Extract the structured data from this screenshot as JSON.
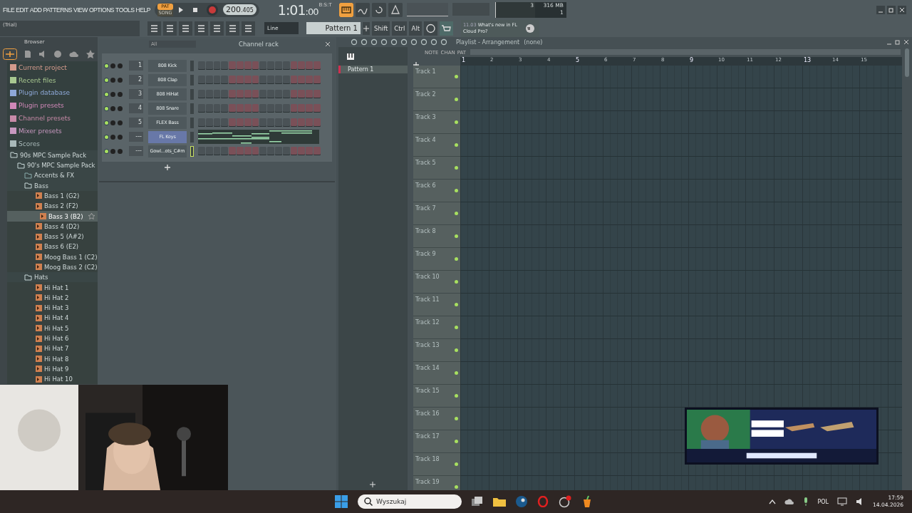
{
  "menu": [
    "FILE",
    "EDIT",
    "ADD",
    "PATTERNS",
    "VIEW",
    "OPTIONS",
    "TOOLS",
    "HELP"
  ],
  "transport": {
    "pat_label": "PAT",
    "song_label": "SONG",
    "song_mode": false,
    "recording": false,
    "tempo": "200",
    "tempo_fraction": ".405",
    "time": "1:01",
    "time_ticks": ":00",
    "time_format": "B:S:T"
  },
  "monitor": {
    "cpu": "3",
    "memory": "316 MB",
    "polyphony": "1"
  },
  "hint_bar": "(Trial)",
  "toolbar": {
    "snap": "Line",
    "pattern": "Pattern 1",
    "modifiers": [
      "Shift",
      "Ctrl",
      "Alt"
    ]
  },
  "news": {
    "time": "11.03",
    "text": "What's new in FL Cloud Pro?"
  },
  "browser": {
    "title": "Browser",
    "items": [
      {
        "label": "Current project",
        "kind": "shortcut",
        "color": "#d49a8c",
        "selected": false
      },
      {
        "label": "Recent files",
        "kind": "shortcut",
        "color": "#a8c890",
        "selected": false
      },
      {
        "label": "Plugin database",
        "kind": "shortcut",
        "color": "#8ea8d8",
        "selected": false
      },
      {
        "label": "Plugin presets",
        "kind": "shortcut",
        "color": "#d088b8",
        "selected": false
      },
      {
        "label": "Channel presets",
        "kind": "shortcut",
        "color": "#c88aa8",
        "selected": false
      },
      {
        "label": "Mixer presets",
        "kind": "shortcut",
        "color": "#c898c0",
        "selected": false
      },
      {
        "label": "Scores",
        "kind": "shortcut",
        "color": "#a8b8b8",
        "selected": false
      },
      {
        "label": "90s MPC Sample Pack",
        "kind": "folder",
        "expanded": true,
        "selected": false,
        "children": [
          {
            "label": "90's MPC Sample Pack",
            "kind": "folder",
            "expanded": true,
            "selected": false,
            "children": [
              {
                "label": "Accents & FX",
                "kind": "folder",
                "expanded": false,
                "selected": false
              },
              {
                "label": "Bass",
                "kind": "folder",
                "expanded": true,
                "selected": false,
                "children": [
                  {
                    "label": "Bass 1 (G2)",
                    "kind": "sample",
                    "selected": false
                  },
                  {
                    "label": "Bass 2 (F2)",
                    "kind": "sample",
                    "selected": false
                  },
                  {
                    "label": "Bass 3 (B2)",
                    "kind": "sample",
                    "selected": true
                  },
                  {
                    "label": "Bass 4 (D2)",
                    "kind": "sample",
                    "selected": false
                  },
                  {
                    "label": "Bass 5 (A#2)",
                    "kind": "sample",
                    "selected": false
                  },
                  {
                    "label": "Bass 6 (E2)",
                    "kind": "sample",
                    "selected": false
                  },
                  {
                    "label": "Moog Bass 1 (C2)",
                    "kind": "sample",
                    "selected": false
                  },
                  {
                    "label": "Moog Bass 2 (C2)",
                    "kind": "sample",
                    "selected": false
                  }
                ]
              },
              {
                "label": "Hats",
                "kind": "folder",
                "expanded": true,
                "selected": false,
                "children": [
                  {
                    "label": "Hi Hat 1",
                    "kind": "sample",
                    "selected": false
                  },
                  {
                    "label": "Hi Hat 2",
                    "kind": "sample",
                    "selected": false
                  },
                  {
                    "label": "Hi Hat 3",
                    "kind": "sample",
                    "selected": false
                  },
                  {
                    "label": "Hi Hat 4",
                    "kind": "sample",
                    "selected": false
                  },
                  {
                    "label": "Hi Hat 5",
                    "kind": "sample",
                    "selected": false
                  },
                  {
                    "label": "Hi Hat 6",
                    "kind": "sample",
                    "selected": false
                  },
                  {
                    "label": "Hi Hat 7",
                    "kind": "sample",
                    "selected": false
                  },
                  {
                    "label": "Hi Hat 8",
                    "kind": "sample",
                    "selected": false
                  },
                  {
                    "label": "Hi Hat 9",
                    "kind": "sample",
                    "selected": false
                  },
                  {
                    "label": "Hi Hat 10",
                    "kind": "sample",
                    "selected": false
                  }
                ]
              }
            ]
          }
        ]
      }
    ]
  },
  "channel_rack": {
    "title": "Channel rack",
    "filter": "All",
    "channels": [
      {
        "number": "1",
        "name": "808 Kick",
        "kind": "steps",
        "highlighted": false,
        "selected": false
      },
      {
        "number": "2",
        "name": "808 Clap",
        "kind": "steps",
        "highlighted": false,
        "selected": false
      },
      {
        "number": "3",
        "name": "808 HiHat",
        "kind": "steps",
        "highlighted": false,
        "selected": false
      },
      {
        "number": "4",
        "name": "808 Snare",
        "kind": "steps",
        "highlighted": false,
        "selected": false
      },
      {
        "number": "5",
        "name": "FLEX Bass",
        "kind": "steps",
        "highlighted": false,
        "selected": false
      },
      {
        "number": "---",
        "name": "FL Keys",
        "kind": "notes",
        "highlighted": true,
        "selected": false
      },
      {
        "number": "---",
        "name": "Gowl...ots_C#m",
        "kind": "steps",
        "highlighted": false,
        "selected": true
      }
    ]
  },
  "playlist": {
    "title": "Playlist - Arrangement",
    "arrangement": "(none)",
    "tool_labels": [
      "NOTE",
      "CHAN",
      "PAT"
    ],
    "patterns": [
      {
        "label": "Pattern 1",
        "selected": true
      }
    ],
    "bars": [
      "1",
      "2",
      "3",
      "4",
      "5",
      "6",
      "7",
      "8",
      "9",
      "10",
      "11",
      "12",
      "13",
      "14",
      "15"
    ],
    "tracks": [
      "Track 1",
      "Track 2",
      "Track 3",
      "Track 4",
      "Track 5",
      "Track 6",
      "Track 7",
      "Track 8",
      "Track 9",
      "Track 10",
      "Track 11",
      "Track 12",
      "Track 13",
      "Track 14",
      "Track 15",
      "Track 16",
      "Track 17",
      "Track 18",
      "Track 19"
    ]
  },
  "taskbar": {
    "search_placeholder": "Wyszukaj",
    "language": "POL",
    "time": "17:59",
    "date": "14.04.2026"
  }
}
